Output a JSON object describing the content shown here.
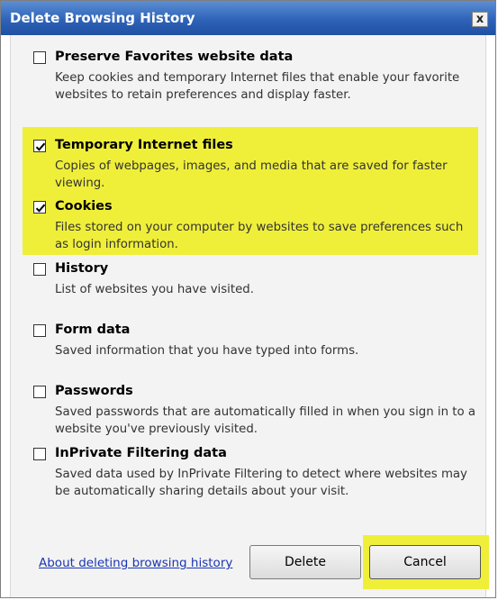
{
  "dialog": {
    "title": "Delete Browsing History",
    "close_glyph": "x"
  },
  "options": [
    {
      "label": "Preserve Favorites website data",
      "description": "Keep cookies and temporary Internet files that enable your favorite websites to retain preferences and display faster.",
      "checked": false
    },
    {
      "label": "Temporary Internet files",
      "description": "Copies of webpages, images, and media that are saved for faster viewing.",
      "checked": true
    },
    {
      "label": "Cookies",
      "description": "Files stored on your computer by websites to save preferences such as login information.",
      "checked": true
    },
    {
      "label": "History",
      "description": "List of websites you have visited.",
      "checked": false
    },
    {
      "label": "Form data",
      "description": "Saved information that you have typed into forms.",
      "checked": false
    },
    {
      "label": "Passwords",
      "description": "Saved passwords that are automatically filled in when you sign in to a website you've previously visited.",
      "checked": false
    },
    {
      "label": "InPrivate Filtering data",
      "description": "Saved data used by InPrivate Filtering to detect where websites may be automatically sharing details about your visit.",
      "checked": false
    }
  ],
  "footer": {
    "help_link": "About deleting browsing history",
    "delete_label": "Delete",
    "cancel_label": "Cancel"
  },
  "colors": {
    "highlight": "#efef3a",
    "titlebar": "#2e63b8",
    "link": "#1a35b4"
  },
  "icons": {
    "close": "close-icon",
    "checkmark": "checkmark-icon"
  }
}
